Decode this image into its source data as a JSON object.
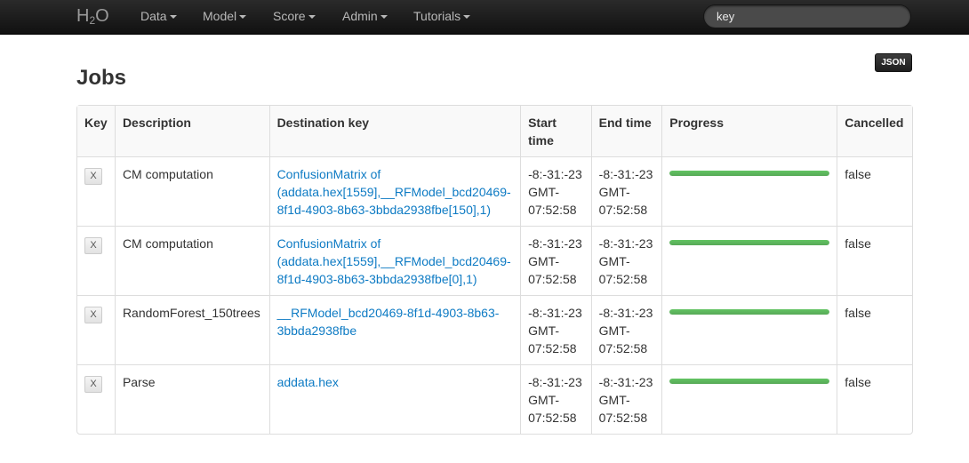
{
  "navbar": {
    "brand_main": "H",
    "brand_sub": "2",
    "brand_tail": "O",
    "menus": [
      "Data",
      "Model",
      "Score",
      "Admin",
      "Tutorials"
    ],
    "search_value": "key"
  },
  "json_button": "JSON",
  "page_title": "Jobs",
  "table": {
    "headers": [
      "Key",
      "Description",
      "Destination key",
      "Start time",
      "End time",
      "Progress",
      "Cancelled"
    ],
    "rows": [
      {
        "key_button": "X",
        "description": "CM computation",
        "destination": "ConfusionMatrix of (addata.hex[1559],__RFModel_bcd20469-8f1d-4903-8b63-3bbda2938fbe[150],1)",
        "start_time": "-8:-31:-23 GMT-07:52:58",
        "end_time": "-8:-31:-23 GMT-07:52:58",
        "progress": 1.0,
        "cancelled": "false"
      },
      {
        "key_button": "X",
        "description": "CM computation",
        "destination": "ConfusionMatrix of (addata.hex[1559],__RFModel_bcd20469-8f1d-4903-8b63-3bbda2938fbe[0],1)",
        "start_time": "-8:-31:-23 GMT-07:52:58",
        "end_time": "-8:-31:-23 GMT-07:52:58",
        "progress": 1.0,
        "cancelled": "false"
      },
      {
        "key_button": "X",
        "description": "RandomForest_150trees",
        "destination": "__RFModel_bcd20469-8f1d-4903-8b63-3bbda2938fbe",
        "start_time": "-8:-31:-23 GMT-07:52:58",
        "end_time": "-8:-31:-23 GMT-07:52:58",
        "progress": 1.0,
        "cancelled": "false"
      },
      {
        "key_button": "X",
        "description": "Parse",
        "destination": "addata.hex",
        "start_time": "-8:-31:-23 GMT-07:52:58",
        "end_time": "-8:-31:-23 GMT-07:52:58",
        "progress": 1.0,
        "cancelled": "false"
      }
    ]
  },
  "colors": {
    "navbar": "#1b1b1b",
    "link": "#0e7bc4",
    "progress": "#5cb85c"
  }
}
